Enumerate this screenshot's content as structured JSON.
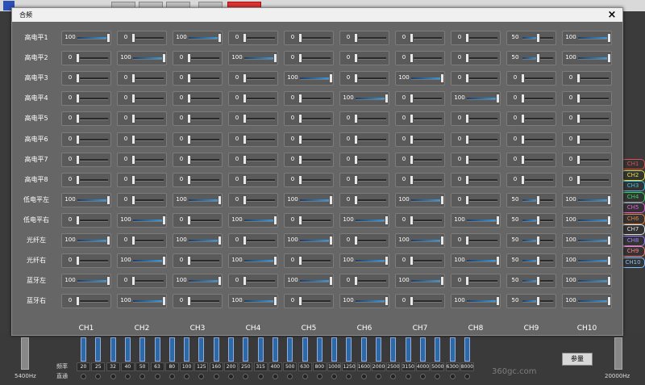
{
  "dialog": {
    "title": "合频",
    "close_glyph": "×"
  },
  "rows": [
    {
      "label": "高电平1",
      "values": [
        100,
        0,
        100,
        0,
        0,
        0,
        0,
        0,
        50,
        100
      ]
    },
    {
      "label": "高电平2",
      "values": [
        0,
        100,
        0,
        100,
        0,
        0,
        0,
        0,
        50,
        100
      ]
    },
    {
      "label": "高电平3",
      "values": [
        0,
        0,
        0,
        0,
        100,
        0,
        100,
        0,
        0,
        0
      ]
    },
    {
      "label": "高电平4",
      "values": [
        0,
        0,
        0,
        0,
        0,
        100,
        0,
        100,
        0,
        0
      ]
    },
    {
      "label": "高电平5",
      "values": [
        0,
        0,
        0,
        0,
        0,
        0,
        0,
        0,
        0,
        0
      ]
    },
    {
      "label": "高电平6",
      "values": [
        0,
        0,
        0,
        0,
        0,
        0,
        0,
        0,
        0,
        0
      ]
    },
    {
      "label": "高电平7",
      "values": [
        0,
        0,
        0,
        0,
        0,
        0,
        0,
        0,
        0,
        0
      ]
    },
    {
      "label": "高电平8",
      "values": [
        0,
        0,
        0,
        0,
        0,
        0,
        0,
        0,
        0,
        0
      ]
    },
    {
      "label": "低电平左",
      "values": [
        100,
        0,
        100,
        0,
        100,
        0,
        100,
        0,
        50,
        100
      ]
    },
    {
      "label": "低电平右",
      "values": [
        0,
        100,
        0,
        100,
        0,
        100,
        0,
        100,
        50,
        100
      ]
    },
    {
      "label": "光纤左",
      "values": [
        100,
        0,
        100,
        0,
        100,
        0,
        100,
        0,
        50,
        100
      ]
    },
    {
      "label": "光纤右",
      "values": [
        0,
        100,
        0,
        100,
        0,
        100,
        0,
        100,
        50,
        100
      ]
    },
    {
      "label": "蓝牙左",
      "values": [
        100,
        0,
        100,
        0,
        100,
        0,
        100,
        0,
        50,
        100
      ]
    },
    {
      "label": "蓝牙右",
      "values": [
        0,
        100,
        0,
        100,
        0,
        100,
        0,
        100,
        50,
        100
      ]
    }
  ],
  "channels": [
    "CH1",
    "CH2",
    "CH3",
    "CH4",
    "CH5",
    "CH6",
    "CH7",
    "CH8",
    "CH9",
    "CH10"
  ],
  "background": {
    "chips": [
      {
        "label": "CH1",
        "color": "#e05050"
      },
      {
        "label": "CH2",
        "color": "#e0e040"
      },
      {
        "label": "CH3",
        "color": "#40c0e0"
      },
      {
        "label": "CH4",
        "color": "#40d060"
      },
      {
        "label": "CH5",
        "color": "#e060e0"
      },
      {
        "label": "CH6",
        "color": "#e08040"
      },
      {
        "label": "CH7",
        "color": "#e0e0e0"
      },
      {
        "label": "CH8",
        "color": "#a080ff"
      },
      {
        "label": "CH9",
        "color": "#ff8080"
      },
      {
        "label": "CH10",
        "color": "#80c0ff"
      }
    ],
    "left_freq_label": "5400Hz",
    "right_freq_label": "20000Hz",
    "eq_row1_label": "频率",
    "eq_row2_label": "直通",
    "frequencies": [
      "20",
      "25",
      "32",
      "40",
      "50",
      "63",
      "80",
      "100",
      "125",
      "160",
      "200",
      "250",
      "315",
      "400",
      "500",
      "630",
      "800",
      "1000",
      "1250",
      "1600",
      "2000",
      "2500",
      "3150",
      "4000",
      "5000",
      "6300",
      "8000"
    ],
    "param_button_label": "参量",
    "watermark": "360gc.com"
  }
}
